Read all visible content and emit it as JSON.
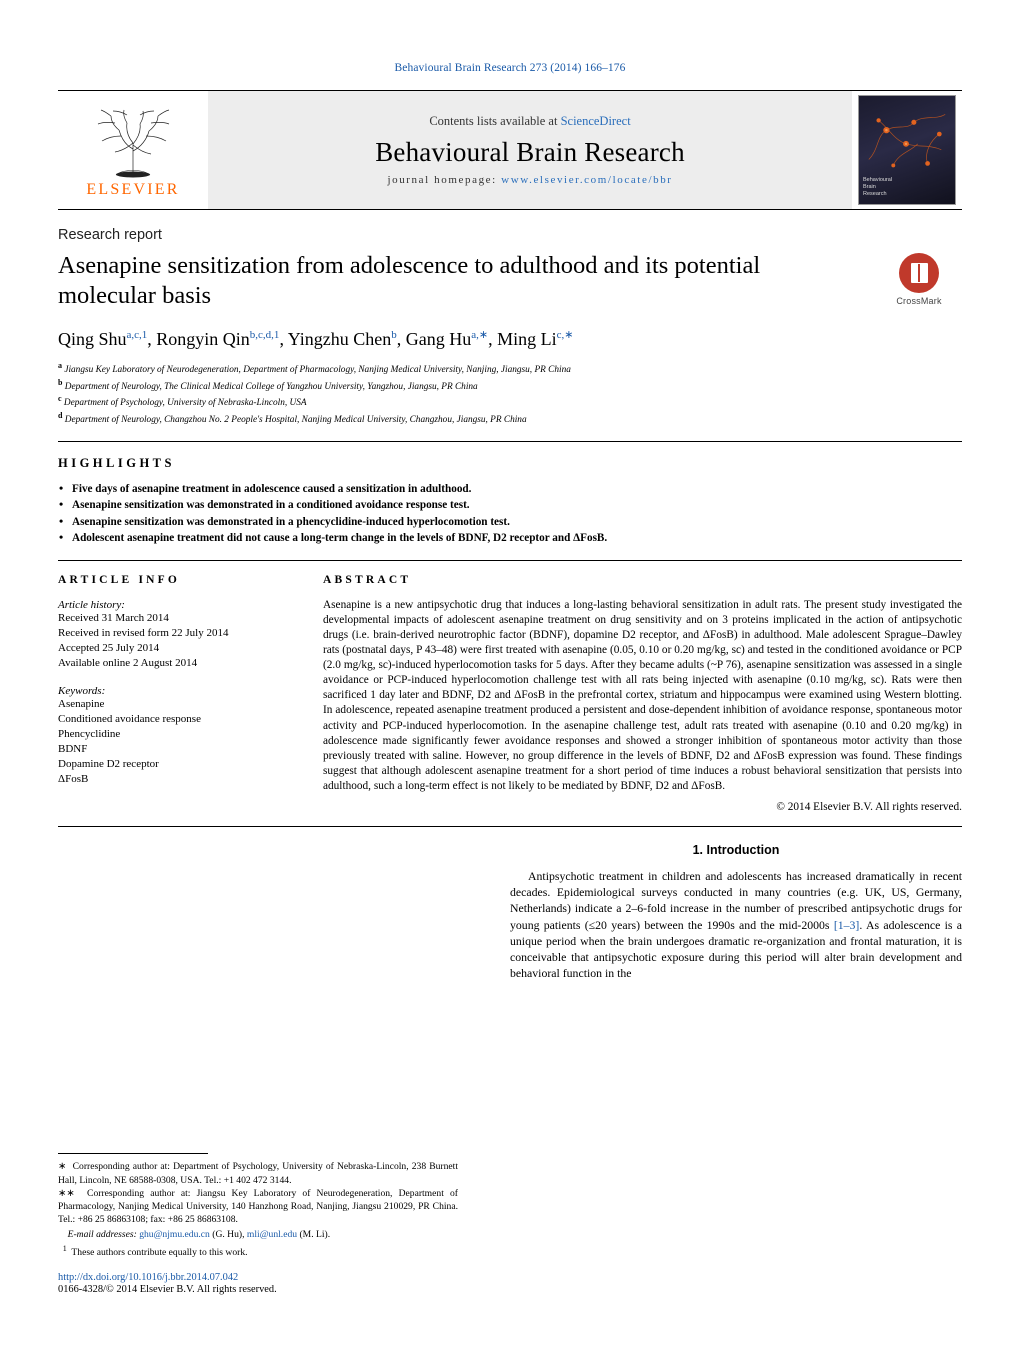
{
  "runhead": "Behavioural Brain Research 273 (2014) 166–176",
  "masthead": {
    "contents_pre": "Contents lists available at ",
    "contents_link": "ScienceDirect",
    "journal": "Behavioural Brain Research",
    "homepage_label": "journal homepage:",
    "homepage_url": "www.elsevier.com/locate/bbr",
    "publisher": "ELSEVIER",
    "cover_text": "Behavioural\nBrain\nResearch"
  },
  "article": {
    "section_type": "Research report",
    "title": "Asenapine sensitization from adolescence to adulthood and its potential molecular basis",
    "crossmark_label": "CrossMark",
    "authors": [
      {
        "name": "Qing Shu",
        "marks": "a,c,1"
      },
      {
        "name": "Rongyin Qin",
        "marks": "b,c,d,1"
      },
      {
        "name": "Yingzhu Chen",
        "marks": "b"
      },
      {
        "name": "Gang Hu",
        "marks": "a,∗"
      },
      {
        "name": "Ming Li",
        "marks": "c,∗"
      }
    ],
    "affiliations": [
      {
        "mark": "a",
        "text": "Jiangsu Key Laboratory of Neurodegeneration, Department of Pharmacology, Nanjing Medical University, Nanjing, Jiangsu, PR China"
      },
      {
        "mark": "b",
        "text": "Department of Neurology, The Clinical Medical College of Yangzhou University, Yangzhou, Jiangsu, PR China"
      },
      {
        "mark": "c",
        "text": "Department of Psychology, University of Nebraska-Lincoln, USA"
      },
      {
        "mark": "d",
        "text": "Department of Neurology, Changzhou No. 2 People's Hospital, Nanjing Medical University, Changzhou, Jiangsu, PR China"
      }
    ]
  },
  "highlights": {
    "heading": "HIGHLIGHTS",
    "items": [
      "Five days of asenapine treatment in adolescence caused a sensitization in adulthood.",
      "Asenapine sensitization was demonstrated in a conditioned avoidance response test.",
      "Asenapine sensitization was demonstrated in a phencyclidine-induced hyperlocomotion test.",
      "Adolescent asenapine treatment did not cause a long-term change in the levels of BDNF, D2 receptor and ΔFosB."
    ]
  },
  "article_info": {
    "heading": "ARTICLE INFO",
    "history_title": "Article history:",
    "history": [
      "Received 31 March 2014",
      "Received in revised form 22 July 2014",
      "Accepted 25 July 2014",
      "Available online 2 August 2014"
    ],
    "keywords_title": "Keywords:",
    "keywords": [
      "Asenapine",
      "Conditioned avoidance response",
      "Phencyclidine",
      "BDNF",
      "Dopamine D2 receptor",
      "ΔFosB"
    ]
  },
  "abstract": {
    "heading": "ABSTRACT",
    "text": "Asenapine is a new antipsychotic drug that induces a long-lasting behavioral sensitization in adult rats. The present study investigated the developmental impacts of adolescent asenapine treatment on drug sensitivity and on 3 proteins implicated in the action of antipsychotic drugs (i.e. brain-derived neurotrophic factor (BDNF), dopamine D2 receptor, and ΔFosB) in adulthood. Male adolescent Sprague–Dawley rats (postnatal days, P 43–48) were first treated with asenapine (0.05, 0.10 or 0.20 mg/kg, sc) and tested in the conditioned avoidance or PCP (2.0 mg/kg, sc)-induced hyperlocomotion tasks for 5 days. After they became adults (~P 76), asenapine sensitization was assessed in a single avoidance or PCP-induced hyperlocomotion challenge test with all rats being injected with asenapine (0.10 mg/kg, sc). Rats were then sacrificed 1 day later and BDNF, D2 and ΔFosB in the prefrontal cortex, striatum and hippocampus were examined using Western blotting. In adolescence, repeated asenapine treatment produced a persistent and dose-dependent inhibition of avoidance response, spontaneous motor activity and PCP-induced hyperlocomotion. In the asenapine challenge test, adult rats treated with asenapine (0.10 and 0.20 mg/kg) in adolescence made significantly fewer avoidance responses and showed a stronger inhibition of spontaneous motor activity than those previously treated with saline. However, no group difference in the levels of BDNF, D2 and ΔFosB expression was found. These findings suggest that although adolescent asenapine treatment for a short period of time induces a robust behavioral sensitization that persists into adulthood, such a long-term effect is not likely to be mediated by BDNF, D2 and ΔFosB.",
    "copyright": "© 2014 Elsevier B.V. All rights reserved."
  },
  "introduction": {
    "heading": "1.  Introduction",
    "paragraph_part1": "Antipsychotic treatment in children and adolescents has increased dramatically in recent decades. Epidemiological surveys conducted in many countries (e.g. UK, US, Germany, Netherlands) indicate a 2–6-fold increase in the number of prescribed antipsychotic drugs for young patients (≤20 years) between the 1990s and the mid-2000s ",
    "citation": "[1–3]",
    "paragraph_part2": ". As adolescence is a unique period when the brain undergoes dramatic re-organization and frontal maturation, it is conceivable that antipsychotic exposure during this period will alter brain development and behavioral function in the"
  },
  "footnotes": {
    "corr1": "Corresponding author at: Department of Psychology, University of Nebraska-Lincoln, 238 Burnett Hall, Lincoln, NE 68588-0308, USA. Tel.: +1 402 472 3144.",
    "corr2": "Corresponding author at: Jiangsu Key Laboratory of Neurodegeneration, Department of Pharmacology, Nanjing Medical University, 140 Hanzhong Road, Nanjing, Jiangsu 210029, PR China. Tel.: +86 25 86863108; fax: +86 25 86863108.",
    "email_label": "E-mail addresses:",
    "email1": "ghu@njmu.edu.cn",
    "email1_who": "(G. Hu),",
    "email2": "mli@unl.edu",
    "email2_who": "(M. Li).",
    "note1": "These authors contribute equally to this work.",
    "doi": "http://dx.doi.org/10.1016/j.bbr.2014.07.042",
    "issn": "0166-4328/© 2014 Elsevier B.V. All rights reserved."
  }
}
